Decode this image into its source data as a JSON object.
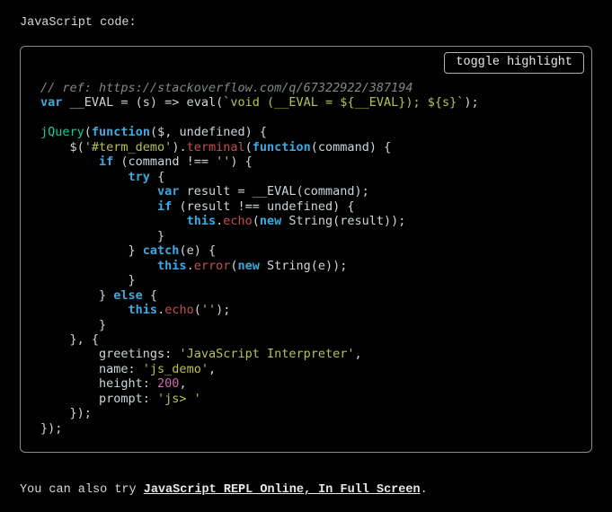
{
  "intro_label": "JavaScript code:",
  "toggle_label": "toggle highlight",
  "outro_prefix": "You can also try ",
  "outro_link_text": "JavaScript REPL Online, In Full Screen",
  "outro_suffix": ".",
  "code": {
    "comment_ref": "// ref: https://stackoverflow.com/q/67322922/387194",
    "kw_var": "var",
    "eval_lhs": " __EVAL = (s) => eval(",
    "eval_tpl": "`void (__EVAL = ${__EVAL}); ${s}`",
    "eval_end": ");",
    "jquery_name": "jQuery",
    "jquery_args_open": "(",
    "kw_function": "function",
    "jq_fn_args": "($, undefined) {",
    "jq_dollar_open": "    $(",
    "sel_str": "'#term_demo'",
    "jq_dot": ").",
    "m_terminal": "terminal",
    "term_open": "(",
    "term_fn_args": "(command) {",
    "kw_if": "if",
    "if_cond_open": " (command !== ",
    "empty_str": "''",
    "if_cond_close": ") {",
    "kw_try": "try",
    "try_open": " {",
    "kw_var2": "var",
    "var_result": " result = __EVAL(command);",
    "kw_if2": "if",
    "if2_cond": " (result !== undefined) {",
    "kw_this": "this",
    "dot": ".",
    "m_echo": "echo",
    "echo_open": "(",
    "kw_new": "new",
    "str_ctor": " String(result));",
    "brace_close": "                }",
    "try_close": "            } ",
    "kw_catch": "catch",
    "catch_args": "(e) {",
    "m_error": "error",
    "err_open": "(",
    "err_rest": " String(e));",
    "catch_close": "            }",
    "if_close": "        } ",
    "kw_else": "else",
    "else_open": " {",
    "echo2_open": "(",
    "else_rest": ");",
    "else_close": "        }",
    "fn_close_comma": "    }, {",
    "opt_greet_k": "        greetings: ",
    "opt_greet_v": "'JavaScript Interpreter'",
    "opt_name_k": "        name: ",
    "opt_name_v": "'js_demo'",
    "opt_height_k": "        height: ",
    "opt_height_v": "200",
    "opt_prompt_k": "        prompt: ",
    "opt_prompt_v": "'js> '",
    "opts_close": "    });",
    "outer_close": "});",
    "comma": ","
  }
}
